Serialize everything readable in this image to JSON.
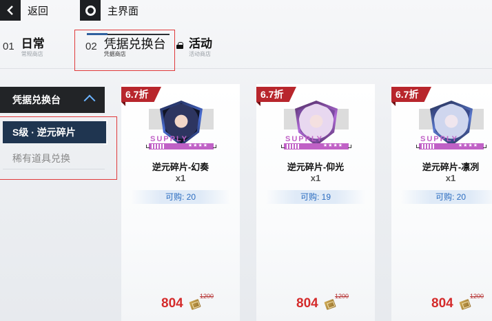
{
  "topbar": {
    "back_label": "返回",
    "home_label": "主界面"
  },
  "tabs": [
    {
      "num": "01",
      "title": "日常",
      "sub": "常规商店"
    },
    {
      "num": "02",
      "title": "凭据兑换台",
      "sub": "凭据商店"
    },
    {
      "title": "活动",
      "sub": "活动商店"
    }
  ],
  "sidebar": {
    "header": "凭据兑换台",
    "items": [
      {
        "label": "S级 · 逆元碎片"
      },
      {
        "label": "稀有道具兑换"
      }
    ]
  },
  "cards": [
    {
      "discount": "6.7折",
      "supply": "SUPPLY",
      "stars": "★★★★",
      "name": "逆元碎片-幻奏",
      "qty": "x1",
      "stock": "可购: 20",
      "price": "804",
      "orig_price": "1200",
      "accent": "#4a6fd6"
    },
    {
      "discount": "6.7折",
      "supply": "SUPPLY",
      "stars": "★★★★",
      "name": "逆元碎片-仰光",
      "qty": "x1",
      "stock": "可购: 19",
      "price": "804",
      "orig_price": "1200",
      "accent": "#b06ad8"
    },
    {
      "discount": "6.7折",
      "supply": "SUPPLY",
      "stars": "★★★★",
      "name": "逆元碎片-凛冽",
      "qty": "x1",
      "stock": "可购: 20",
      "price": "804",
      "orig_price": "1200",
      "accent": "#5a79d0"
    }
  ],
  "colors": {
    "discount_red": "#b8262c",
    "supply_purple": "#c061c6",
    "price_red": "#d42b2b",
    "highlight_box": "#e0393a",
    "stock_blue": "#2a6cc0"
  }
}
